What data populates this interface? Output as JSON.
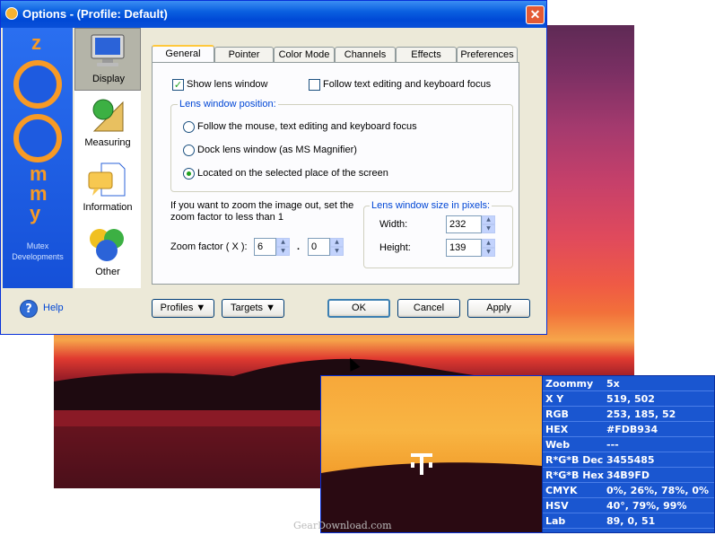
{
  "window": {
    "title": "Options - (Profile: Default)",
    "close_glyph": "✕"
  },
  "brand": {
    "letters": [
      "m",
      "m",
      "y"
    ],
    "caption_line1": "Mutex",
    "caption_line2": "Developments"
  },
  "nav": [
    {
      "label": "Display",
      "icon": "monitor-icon",
      "selected": true
    },
    {
      "label": "Measuring",
      "icon": "ruler-ball-icon",
      "selected": false
    },
    {
      "label": "Information",
      "icon": "info-icon",
      "selected": false
    },
    {
      "label": "Other",
      "icon": "balls-icon",
      "selected": false
    }
  ],
  "tabs": [
    {
      "label": "General",
      "selected": true
    },
    {
      "label": "Pointer"
    },
    {
      "label": "Color Mode"
    },
    {
      "label": "Channels"
    },
    {
      "label": "Effects"
    },
    {
      "label": "Preferences"
    }
  ],
  "general": {
    "show_lens_window": {
      "label": "Show lens window",
      "checked": true
    },
    "follow_text_editing": {
      "label": "Follow text editing and keyboard focus",
      "checked": false
    },
    "position_group_title": "Lens window position:",
    "positions": [
      {
        "label": "Follow the mouse, text editing and keyboard focus",
        "selected": false
      },
      {
        "label": "Dock lens window (as MS Magnifier)",
        "selected": false
      },
      {
        "label": "Located on the selected place of the screen",
        "selected": true
      }
    ],
    "zoom_hint_line1": "If you want to zoom the image out, set the",
    "zoom_hint_line2": "zoom factor to less than 1",
    "zoom_label": "Zoom factor ( X ):",
    "zoom_int": "6",
    "zoom_sep": ".",
    "zoom_frac": "0",
    "size_group_title": "Lens window size in pixels:",
    "width_label": "Width:",
    "width_value": "232",
    "height_label": "Height:",
    "height_value": "139"
  },
  "footer": {
    "help": "Help",
    "profiles": "Profiles",
    "targets": "Targets",
    "ok": "OK",
    "cancel": "Cancel",
    "apply": "Apply"
  },
  "info_panel": [
    {
      "key": "Zoommy",
      "value": "5x"
    },
    {
      "key": "X Y",
      "value": "519, 502"
    },
    {
      "key": "RGB",
      "value": "253, 185, 52"
    },
    {
      "key": "HEX",
      "value": "#FDB934"
    },
    {
      "key": "Web",
      "value": "---"
    },
    {
      "key": "R*G*B Dec",
      "value": "3455485"
    },
    {
      "key": "R*G*B Hex",
      "value": "34B9FD"
    },
    {
      "key": "CMYK",
      "value": "0%, 26%, 78%, 0%"
    },
    {
      "key": "HSV",
      "value": "40°, 79%, 99%"
    },
    {
      "key": "Lab",
      "value": "89, 0, 51"
    }
  ],
  "watermark": "GearDownload.com",
  "colors": {
    "accent": "#0a5fe0",
    "brand_orange": "#f79a25",
    "sampled": "#FDB934"
  }
}
